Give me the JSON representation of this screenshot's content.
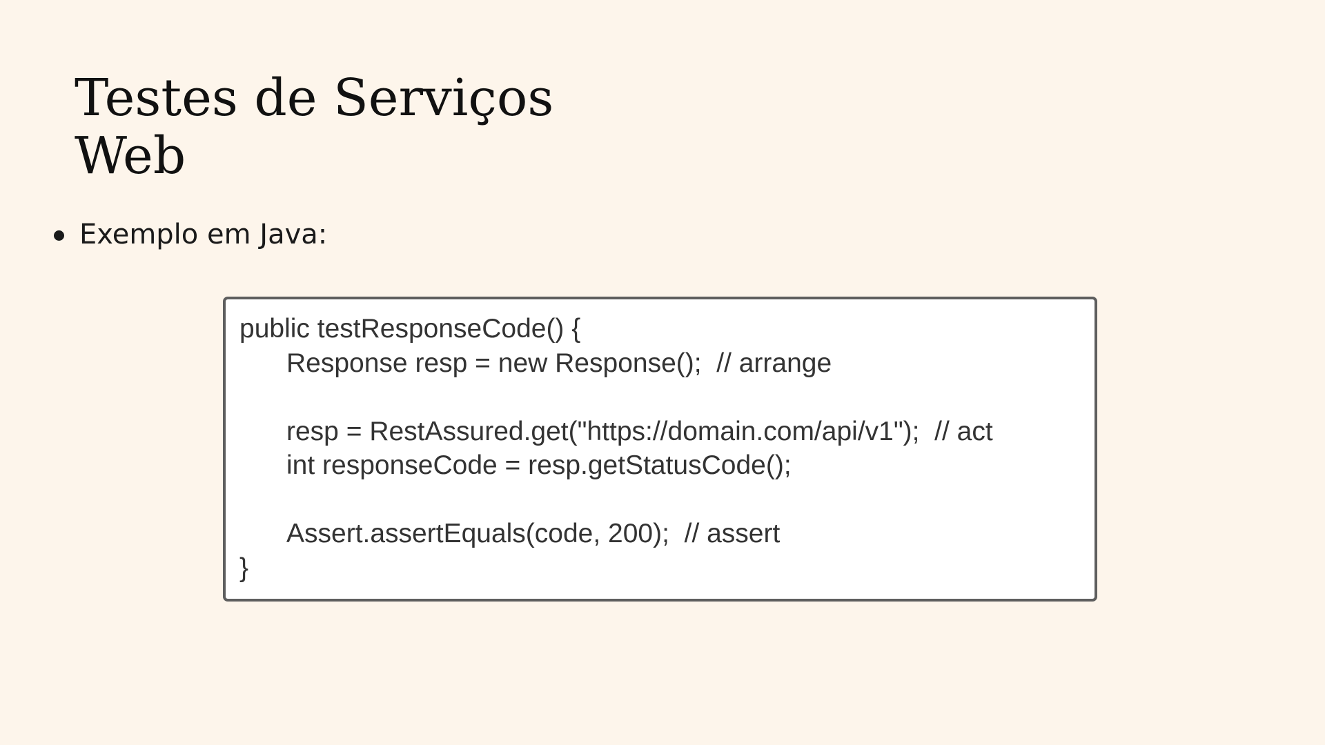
{
  "slide": {
    "title_lines": [
      "Testes de Serviços",
      "Web"
    ],
    "bullets": [
      "Exemplo em Java:"
    ]
  },
  "code_block": {
    "language": "Java",
    "lines": [
      "public testResponseCode() {",
      "Response resp = new Response();  // arrange",
      "",
      "resp = RestAssured.get(\"https://domain.com/api/v1\");  // act",
      "int responseCode = resp.getStatusCode();",
      "",
      "Assert.assertEquals(code, 200);  // assert",
      "}"
    ]
  },
  "colors": {
    "background": "#fdf5eb",
    "title_text": "#111111",
    "code_border": "#5e5e5e",
    "code_background": "#ffffff",
    "code_text": "#333333"
  }
}
